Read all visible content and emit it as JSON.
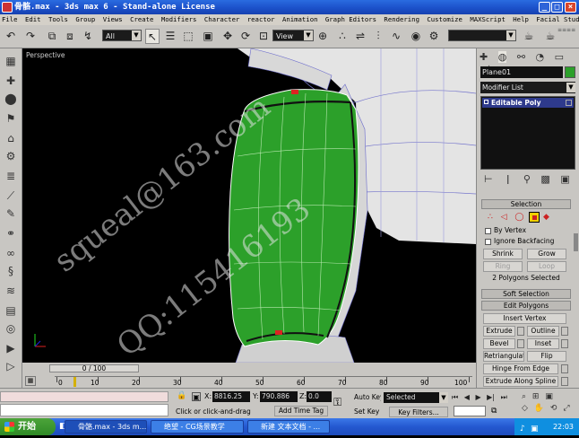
{
  "window": {
    "title": "骨骼.max - 3ds max 6 - Stand-alone License"
  },
  "menu": [
    "File",
    "Edit",
    "Tools",
    "Group",
    "Views",
    "Create",
    "Modifiers",
    "Character",
    "reactor",
    "Animation",
    "Graph Editors",
    "Rendering",
    "Customize",
    "MAXScript",
    "Help",
    "Facial Studio"
  ],
  "toolbar": {
    "selection_filter": "All",
    "reference_coord": "View"
  },
  "viewport": {
    "label": "Perspective"
  },
  "watermark": {
    "line1": "squeal@163.com",
    "line2": "QQ:115416193"
  },
  "timeslider": {
    "label": "0 / 100"
  },
  "timeline": {
    "ticks": [
      "0",
      "10",
      "20",
      "30",
      "40",
      "50",
      "60",
      "70",
      "80",
      "90",
      "100"
    ]
  },
  "command_panel": {
    "object_name": "Plane01",
    "modifier_list": "Modifier List",
    "stack_item": "Editable Poly",
    "selection_header": "Selection",
    "by_vertex": "By Vertex",
    "ignore_backfacing": "Ignore Backfacing",
    "shrink": "Shrink",
    "grow": "Grow",
    "ring": "Ring",
    "loop": "Loop",
    "selected_info": "2 Polygons Selected",
    "soft_selection": "Soft Selection",
    "edit_polygons": "Edit Polygons",
    "insert_vertex": "Insert Vertex",
    "extrude": "Extrude",
    "outline": "Outline",
    "bevel": "Bevel",
    "inset": "Inset",
    "retriangulate": "Retriangulate",
    "flip": "Flip",
    "hinge_from_edge": "Hinge From Edge",
    "extrude_along_spline": "Extrude Along Spline"
  },
  "status": {
    "x_label": "X:",
    "x_value": "8816.25",
    "y_label": "Y:",
    "y_value": "790.886",
    "z_label": "Z:",
    "z_value": "0.0",
    "prompt": "Click or click-and-drag",
    "add_time_tag": "Add Time Tag",
    "auto_key": "Auto Key",
    "selected": "Selected",
    "set_key": "Set Key",
    "key_filters": "Key Filters..."
  },
  "taskbar": {
    "start": "开始",
    "items": [
      "骨骼.max - 3ds m...",
      "绝望 - CG场景教学",
      "新建 文本文档 - ..."
    ],
    "clock": "22:03"
  },
  "colors": {
    "viewport_bg": "#000000",
    "object_selected": "#2ca02a",
    "object_wire": "#ffffff",
    "panel_bg": "#c8c6c2"
  }
}
